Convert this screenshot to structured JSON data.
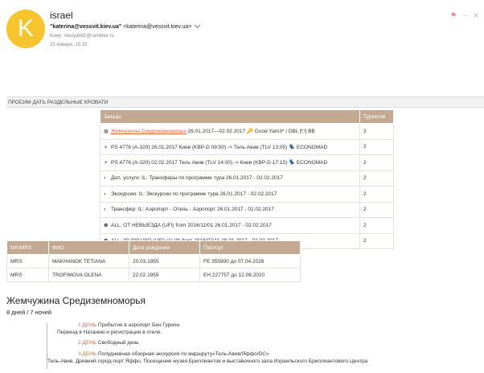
{
  "header": {
    "avatar_letter": "K",
    "sender_name": "israel",
    "from_name": "\"katerina@vessvit.kiev.ua\"",
    "from_email": "<katerina@vessvit.kiev.ua>",
    "to_line": "Кому: rinutyab81@ramblex.ru",
    "date_line": "23 января, 15:19",
    "accent_color": "#f6c42c"
  },
  "request_text": "ПРОСИМ ДАТЬ РАЗДЕЛЬНЫЕ КРОВАТИ",
  "orders": {
    "headers": [
      "Заказы",
      "Туристов"
    ],
    "rows": [
      {
        "icon": "hotel-icon",
        "link": "Жемчужина Средиземноморья",
        "text": " 26.01.2017—02.02.2017 🔑 Good Yam3* / DBL 🍽 BB",
        "count": "2"
      },
      {
        "icon": "plane-icon",
        "link": "",
        "text": "PS 4776 (A-320) 26.01.2017 Киев (KBP-D 09:50) -> Тель Авив (TLV 13:05) 💺 ECONOMAD",
        "count": "2"
      },
      {
        "icon": "plane-icon",
        "link": "",
        "text": "PS 4776 (A-320) 02.02.2017 Тель Авив (TLV 14:00) -> Киев (KBP-D 17:15) 💺 ECONOMAD",
        "count": "2"
      },
      {
        "icon": "service-icon",
        "link": "",
        "text": "Доп. услуги: IL: Трансферы по программе тура 26.01.2017 - 02.02.2017",
        "count": "2"
      },
      {
        "icon": "service-icon",
        "link": "",
        "text": "Экскурсии: IL: Экскурсии по программе тура 26.01.2017 - 02.02.2017",
        "count": "2"
      },
      {
        "icon": "service-icon",
        "link": "",
        "text": "Трансфер: IL: Аэропорт - Отель - Аэропорт 26.01.2017 - 02.02.2017",
        "count": "2"
      },
      {
        "icon": "shield-icon",
        "link": "",
        "text": "ALL: ОТ НЕВЫЕЗДА (UFI) from 2016/11/01 26.01.2017 - 02.02.2017",
        "count": "2"
      },
      {
        "icon": "shield-icon",
        "link": "",
        "text": "ALL: 30 000 USD (UFI) (1) (8) from 2016/07/11 26.01.2017 - 02.02.2017",
        "count": "2"
      }
    ]
  },
  "passengers": {
    "headers": [
      "MR/MRS",
      "ФИО",
      "Дата рождения",
      "Паспорт"
    ],
    "rows": [
      [
        "MRS",
        "MAKHANOK TETIANA",
        "20.03.1955",
        "FE 355900 до 07.04.2026"
      ],
      [
        "MRS",
        "TROFIMOVA OLENA",
        "22.02.1959",
        "EH 227757 до 12.08.2020"
      ]
    ]
  },
  "tour": {
    "title": "Жемчужина Средиземноморья",
    "subtitle": "8 дней / 7 ночей",
    "days": [
      {
        "num": "1 ДЕНЬ",
        "text": " Прибытие в аэропорт Бен Гурион",
        "detail": "Переезд в Натанию и регистрация в отеле."
      },
      {
        "num": "2 ДЕНЬ",
        "text": " Свободный день",
        "detail": ""
      },
      {
        "num": "3 ДЕНЬ",
        "text": " Полудневная обзорная экскурсия по маршруту«Тель-Авив/Яффо/DC»",
        "detail": "Тель-Авив. Древний город-порт Яффо. Посещение музея Бриллиантов и выставочного зала Израильского Бриллиантового Центра"
      }
    ],
    "day_color": "#e8652e"
  },
  "table_header_color": "#c4a992"
}
